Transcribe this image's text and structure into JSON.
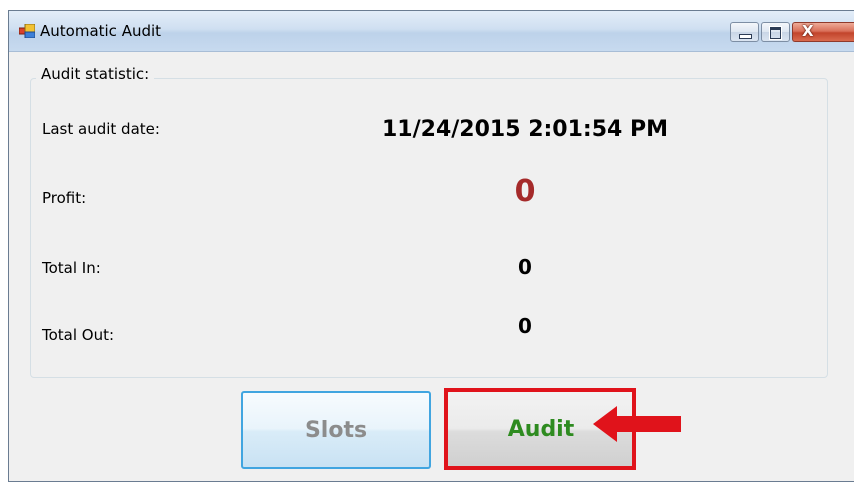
{
  "window": {
    "title": "Automatic Audit",
    "close_glyph": "X"
  },
  "group": {
    "title": "Audit statistic:"
  },
  "stats": {
    "last_audit_label": "Last audit date:",
    "last_audit_value": "11/24/2015 2:01:54 PM",
    "profit_label": "Profit:",
    "profit_value": "0",
    "total_in_label": "Total In:",
    "total_in_value": "0",
    "total_out_label": "Total Out:",
    "total_out_value": "0"
  },
  "buttons": {
    "slots_label": "Slots",
    "audit_label": "Audit"
  },
  "colors": {
    "profit": "#a52a2a",
    "audit_text": "#2e8b20",
    "slots_text": "#8c8c8c",
    "highlight": "#e0131b"
  },
  "icons": [
    "app-icon",
    "minimize-icon",
    "maximize-icon",
    "close-icon",
    "pointer-arrow-icon"
  ]
}
